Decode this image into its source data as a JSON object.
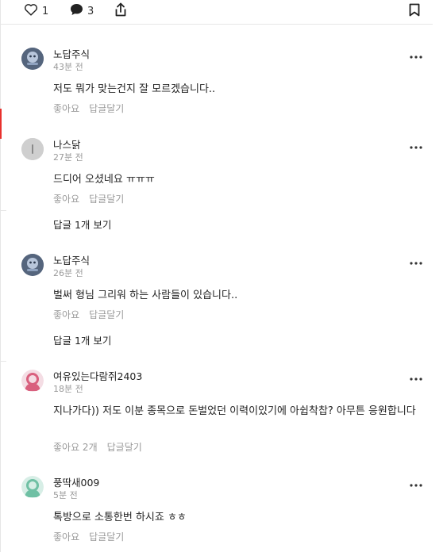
{
  "actionbar": {
    "like_count": "1",
    "comment_count": "3",
    "icons": [
      "heart-icon",
      "chat-bubble-icon",
      "share-icon",
      "bookmark-icon"
    ]
  },
  "comments": [
    {
      "author": "노답주식",
      "time": "43분 전",
      "text": "저도 뭐가 맞는건지 잘 모르겠습니다..",
      "like_label": "좋아요",
      "reply_label": "답글달기"
    },
    {
      "author": "나스닭",
      "time": "27분 전",
      "text": "드디어 오셨네요 ㅠㅠㅠ",
      "like_label": "좋아요",
      "reply_label": "답글달기",
      "view_replies": "답글 1개 보기"
    },
    {
      "author": "노답주식",
      "time": "26분 전",
      "text": "벌써 형님 그리워 하는 사람들이 있습니다..",
      "like_label": "좋아요",
      "reply_label": "답글달기",
      "view_replies": "답글 1개 보기"
    },
    {
      "author": "여유있는다람쥐2403",
      "time": "18분 전",
      "text": "지나가다)) 저도 이분 종목으로 돈벌었던 이력이있기에 아쉽착찹? 아무튼 응원합니다",
      "like_label": "좋아요 2개",
      "reply_label": "답글달기"
    },
    {
      "author": "풍딱새009",
      "time": "5분 전",
      "text": "톡방으로 소통한번 하시죠 ㅎㅎ",
      "like_label": "좋아요",
      "reply_label": "답글달기"
    }
  ],
  "colors": {
    "accent": "#e8312d",
    "muted": "#9a9a9a",
    "divider": "#e6e6e6"
  }
}
